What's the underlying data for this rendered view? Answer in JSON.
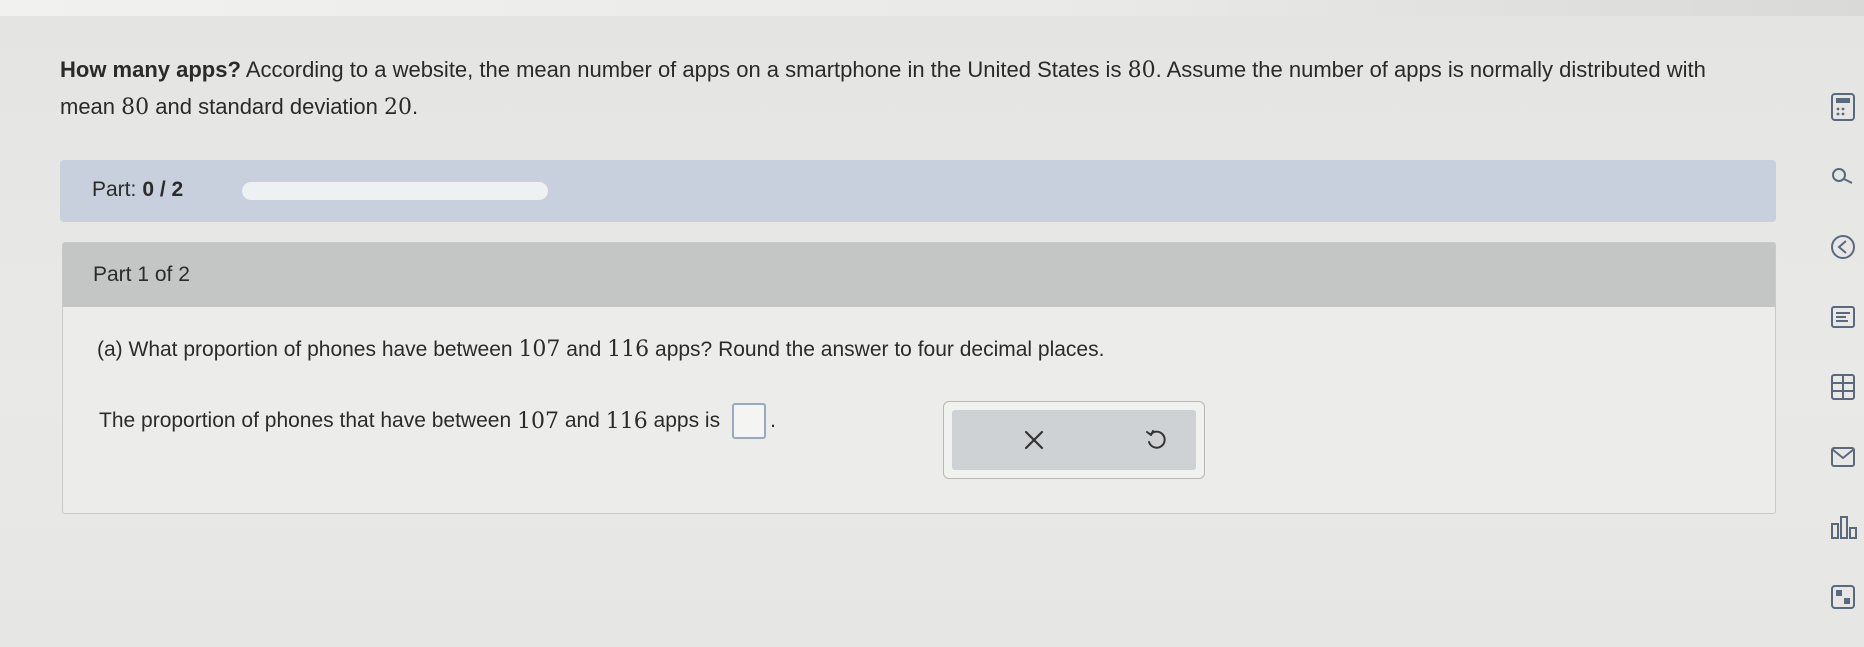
{
  "problem": {
    "title": "How many apps?",
    "text_1": "According to a website, the mean number of apps on a smartphone in the United States is",
    "mean": "80",
    "text_2": ". Assume the number of apps is normally distributed with mean",
    "text_3": "and standard deviation",
    "sd": "20",
    "text_4": "."
  },
  "progress": {
    "label": "Part:",
    "fraction": "0 / 2",
    "fill_fraction": 0
  },
  "part": {
    "header": "Part 1 of 2",
    "question_1": "(a) What proportion of phones have between",
    "low": "107",
    "question_and": "and",
    "high": "116",
    "question_2": "apps? Round the answer to four decimal places.",
    "answer_1": "The proportion of phones that have between",
    "answer_and": "and",
    "answer_2": "apps is",
    "answer_value": "",
    "period": "."
  },
  "tools": {
    "clear_icon": "close-icon",
    "undo_icon": "undo-icon"
  },
  "sidebar": {
    "icons": [
      "calculator-icon",
      "search-icon",
      "arrow-icon",
      "list-icon",
      "table-icon",
      "mail-icon",
      "chart-icon",
      "grid-icon"
    ]
  }
}
